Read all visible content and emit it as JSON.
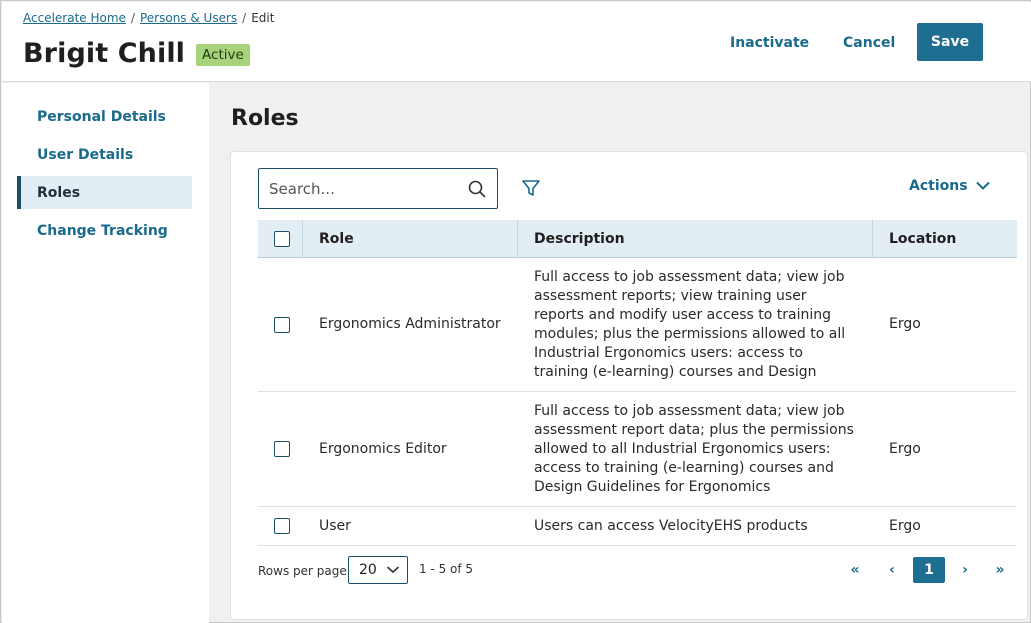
{
  "breadcrumb": {
    "home": "Accelerate Home",
    "sep1": "/",
    "persons": "Persons & Users",
    "sep2": "/",
    "current": "Edit"
  },
  "header": {
    "title": "Brigit Chill",
    "status": "Active",
    "inactivate_label": "Inactivate",
    "cancel_label": "Cancel",
    "save_label": "Save"
  },
  "sidebar": {
    "items": [
      {
        "label": "Personal Details",
        "active": false
      },
      {
        "label": "User Details",
        "active": false
      },
      {
        "label": "Roles",
        "active": true
      },
      {
        "label": "Change Tracking",
        "active": false
      }
    ]
  },
  "main": {
    "section_title": "Roles",
    "search_placeholder": "Search...",
    "actions_label": "Actions",
    "columns": {
      "role": "Role",
      "description": "Description",
      "location": "Location"
    },
    "rows": [
      {
        "role": "Ergonomics Administrator",
        "description": "Full access to job assessment data; view job assessment reports; view training user reports and modify user access to training modules; plus the permissions allowed to all Industrial Ergonomics users: access to training (e-learning) courses and Design",
        "location": "Ergo"
      },
      {
        "role": "Ergonomics Editor",
        "description": "Full access to job assessment data; view job assessment report data; plus the permissions allowed to all Industrial Ergonomics users: access to training (e-learning) courses and Design Guidelines for Ergonomics",
        "location": "Ergo"
      },
      {
        "role": "User",
        "description": "Users can access VelocityEHS products",
        "location": "Ergo"
      }
    ]
  },
  "footer": {
    "rows_per_page_label": "Rows per page",
    "rows_per_page_value": "20",
    "range": "1 - 5 of 5",
    "first": "«",
    "prev": "‹",
    "current_page": "1",
    "next": "›",
    "last": "»"
  },
  "colors": {
    "accent": "#1d6e91",
    "link": "#1a6a8c",
    "badge": "#a7d37a",
    "header_row": "#e3edf4"
  }
}
